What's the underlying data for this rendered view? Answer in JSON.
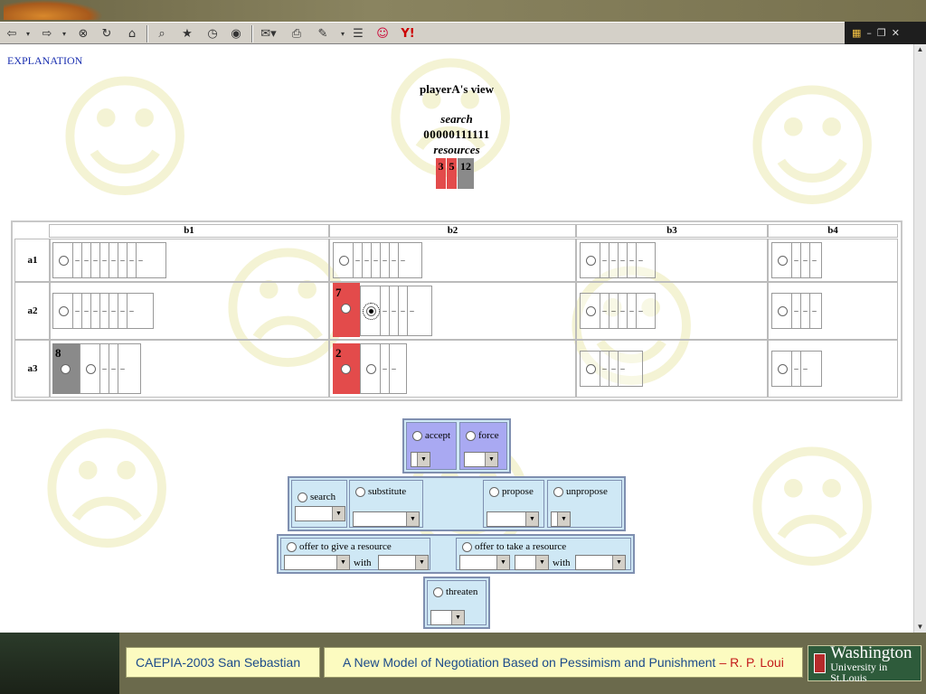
{
  "browser": {
    "toolbar_icons": [
      "back-icon",
      "back-dropdown-icon",
      "forward-icon",
      "forward-dropdown-icon",
      "stop-icon",
      "refresh-icon",
      "home-icon",
      "search-icon",
      "favorites-icon",
      "history-icon",
      "media-icon",
      "mail-icon",
      "print-icon",
      "edit-icon",
      "discuss-icon",
      "messenger-icon",
      "yahoo-icon"
    ],
    "windows_logo": "windows-flag-icon"
  },
  "page": {
    "explanation_link": "EXPLANATION",
    "view_title": "playerA's view",
    "search_label": "search",
    "search_value": "00000111111",
    "resources_label": "resources",
    "resources": [
      {
        "value": "3",
        "color": "#e34b4b"
      },
      {
        "value": "5",
        "color": "#e34b4b"
      },
      {
        "value": "12",
        "color": "#8a8a8a"
      }
    ]
  },
  "grid": {
    "columns": [
      "b1",
      "b2",
      "b3",
      "b4"
    ],
    "rows": [
      "a1",
      "a2",
      "a3"
    ],
    "cells": {
      "a3_b1_value": "8",
      "a2_b2_value": "7",
      "a3_b2_value": "2"
    }
  },
  "actions": {
    "accept": "accept",
    "force": "force",
    "search": "search",
    "substitute": "substitute",
    "propose": "propose",
    "unpropose": "unpropose",
    "offer_give": "offer to give a resource",
    "offer_take": "offer to take a resource",
    "with1": "with",
    "with2": "with",
    "threaten": "threaten"
  },
  "footer": {
    "conference": "CAEPIA-2003 San Sebastian",
    "talk_title": "A New Model of Negotiation Based on Pessimism and Punishment",
    "author": "– R. P. Loui",
    "logo_line1": "Washington",
    "logo_line2": "University in St.Louis"
  },
  "colors": {
    "red": "#e34b4b",
    "gray": "#8a8a8a",
    "panel_blue": "#cfe8f5",
    "panel_violet": "#a9a9f2"
  }
}
